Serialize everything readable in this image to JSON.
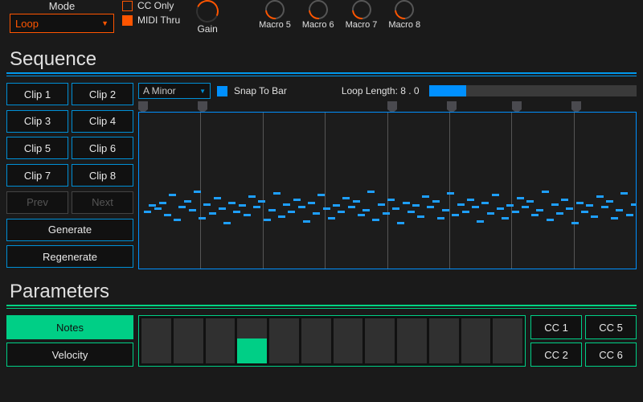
{
  "mode": {
    "label": "Mode",
    "value": "Loop"
  },
  "checks": {
    "cc_only": "CC Only",
    "midi_thru": "MIDI Thru"
  },
  "gain": {
    "label": "Gain"
  },
  "macros": [
    "Macro 5",
    "Macro 6",
    "Macro 7",
    "Macro 8"
  ],
  "sequence": {
    "title": "Sequence",
    "clips": [
      "Clip 1",
      "Clip 2",
      "Clip 3",
      "Clip 4",
      "Clip 5",
      "Clip 6",
      "Clip 7",
      "Clip 8"
    ],
    "prev": "Prev",
    "next": "Next",
    "generate": "Generate",
    "regenerate": "Regenerate",
    "key": "A Minor",
    "snap_label": "Snap To Bar",
    "loop_label": "Loop Length: 8 . 0",
    "loop_fill_pct": 18
  },
  "parameters": {
    "title": "Parameters",
    "tabs": [
      "Notes",
      "Velocity"
    ],
    "active_tab": 0,
    "bar_values": [
      0,
      0,
      0,
      55,
      0,
      0,
      0,
      0,
      0,
      0,
      0,
      0
    ],
    "cc": [
      "CC 1",
      "CC 5",
      "CC 2",
      "CC 6"
    ]
  },
  "marker_positions_pct": [
    0,
    12,
    50,
    62,
    75,
    87
  ],
  "notes": [
    [
      1,
      63
    ],
    [
      2,
      59
    ],
    [
      3,
      61
    ],
    [
      4,
      57
    ],
    [
      5,
      65
    ],
    [
      6,
      52
    ],
    [
      7,
      68
    ],
    [
      8,
      60
    ],
    [
      9,
      56
    ],
    [
      10,
      62
    ],
    [
      11,
      50
    ],
    [
      12,
      67
    ],
    [
      13,
      58
    ],
    [
      14,
      64
    ],
    [
      15,
      54
    ],
    [
      16,
      61
    ],
    [
      17,
      70
    ],
    [
      18,
      57
    ],
    [
      19,
      63
    ],
    [
      20,
      59
    ],
    [
      21,
      65
    ],
    [
      22,
      53
    ],
    [
      23,
      60
    ],
    [
      24,
      56
    ],
    [
      25,
      68
    ],
    [
      26,
      62
    ],
    [
      27,
      51
    ],
    [
      28,
      66
    ],
    [
      29,
      58
    ],
    [
      30,
      63
    ],
    [
      31,
      55
    ],
    [
      32,
      60
    ],
    [
      33,
      69
    ],
    [
      34,
      57
    ],
    [
      35,
      64
    ],
    [
      36,
      52
    ],
    [
      37,
      61
    ],
    [
      38,
      67
    ],
    [
      39,
      59
    ],
    [
      40,
      63
    ],
    [
      41,
      54
    ],
    [
      42,
      60
    ],
    [
      43,
      56
    ],
    [
      44,
      65
    ],
    [
      45,
      62
    ],
    [
      46,
      50
    ],
    [
      47,
      68
    ],
    [
      48,
      58
    ],
    [
      49,
      64
    ],
    [
      50,
      55
    ],
    [
      51,
      61
    ],
    [
      52,
      70
    ],
    [
      53,
      57
    ],
    [
      54,
      63
    ],
    [
      55,
      59
    ],
    [
      56,
      66
    ],
    [
      57,
      53
    ],
    [
      58,
      60
    ],
    [
      59,
      56
    ],
    [
      60,
      67
    ],
    [
      61,
      62
    ],
    [
      62,
      51
    ],
    [
      63,
      65
    ],
    [
      64,
      58
    ],
    [
      65,
      63
    ],
    [
      66,
      55
    ],
    [
      67,
      60
    ],
    [
      68,
      69
    ],
    [
      69,
      57
    ],
    [
      70,
      64
    ],
    [
      71,
      52
    ],
    [
      72,
      61
    ],
    [
      73,
      67
    ],
    [
      74,
      59
    ],
    [
      75,
      63
    ],
    [
      76,
      54
    ],
    [
      77,
      60
    ],
    [
      78,
      56
    ],
    [
      79,
      65
    ],
    [
      80,
      62
    ],
    [
      81,
      50
    ],
    [
      82,
      68
    ],
    [
      83,
      58
    ],
    [
      84,
      64
    ],
    [
      85,
      55
    ],
    [
      86,
      61
    ],
    [
      87,
      70
    ],
    [
      88,
      57
    ],
    [
      89,
      63
    ],
    [
      90,
      59
    ],
    [
      91,
      66
    ],
    [
      92,
      53
    ],
    [
      93,
      60
    ],
    [
      94,
      56
    ],
    [
      95,
      67
    ],
    [
      96,
      62
    ],
    [
      97,
      51
    ],
    [
      98,
      65
    ],
    [
      99,
      58
    ]
  ]
}
